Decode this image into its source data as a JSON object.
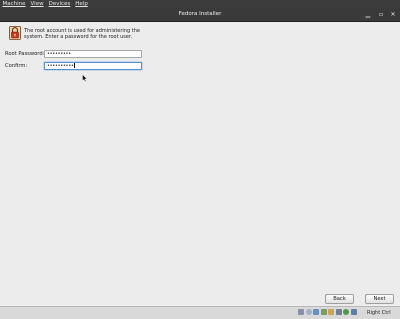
{
  "host_menu": {
    "items": [
      "Machine",
      "View",
      "Devices",
      "Help"
    ]
  },
  "window": {
    "title": "Fedora Installer"
  },
  "installer": {
    "description": "The root account is used for administering the system.  Enter a password for the root user.",
    "root_password_label": "Root Password:",
    "root_password_value": "•••••••••",
    "confirm_label": "Confirm:",
    "confirm_value": "••••••••••"
  },
  "buttons": {
    "back": "Back",
    "next": "Next"
  },
  "statusbar": {
    "host_key": "Right Ctrl",
    "icons": [
      "hard-disk-icon",
      "optical-drive-icon",
      "usb-icon",
      "network-icon",
      "shared-folders-icon",
      "display-icon",
      "capture-icon",
      "mouse-integration-icon"
    ]
  }
}
